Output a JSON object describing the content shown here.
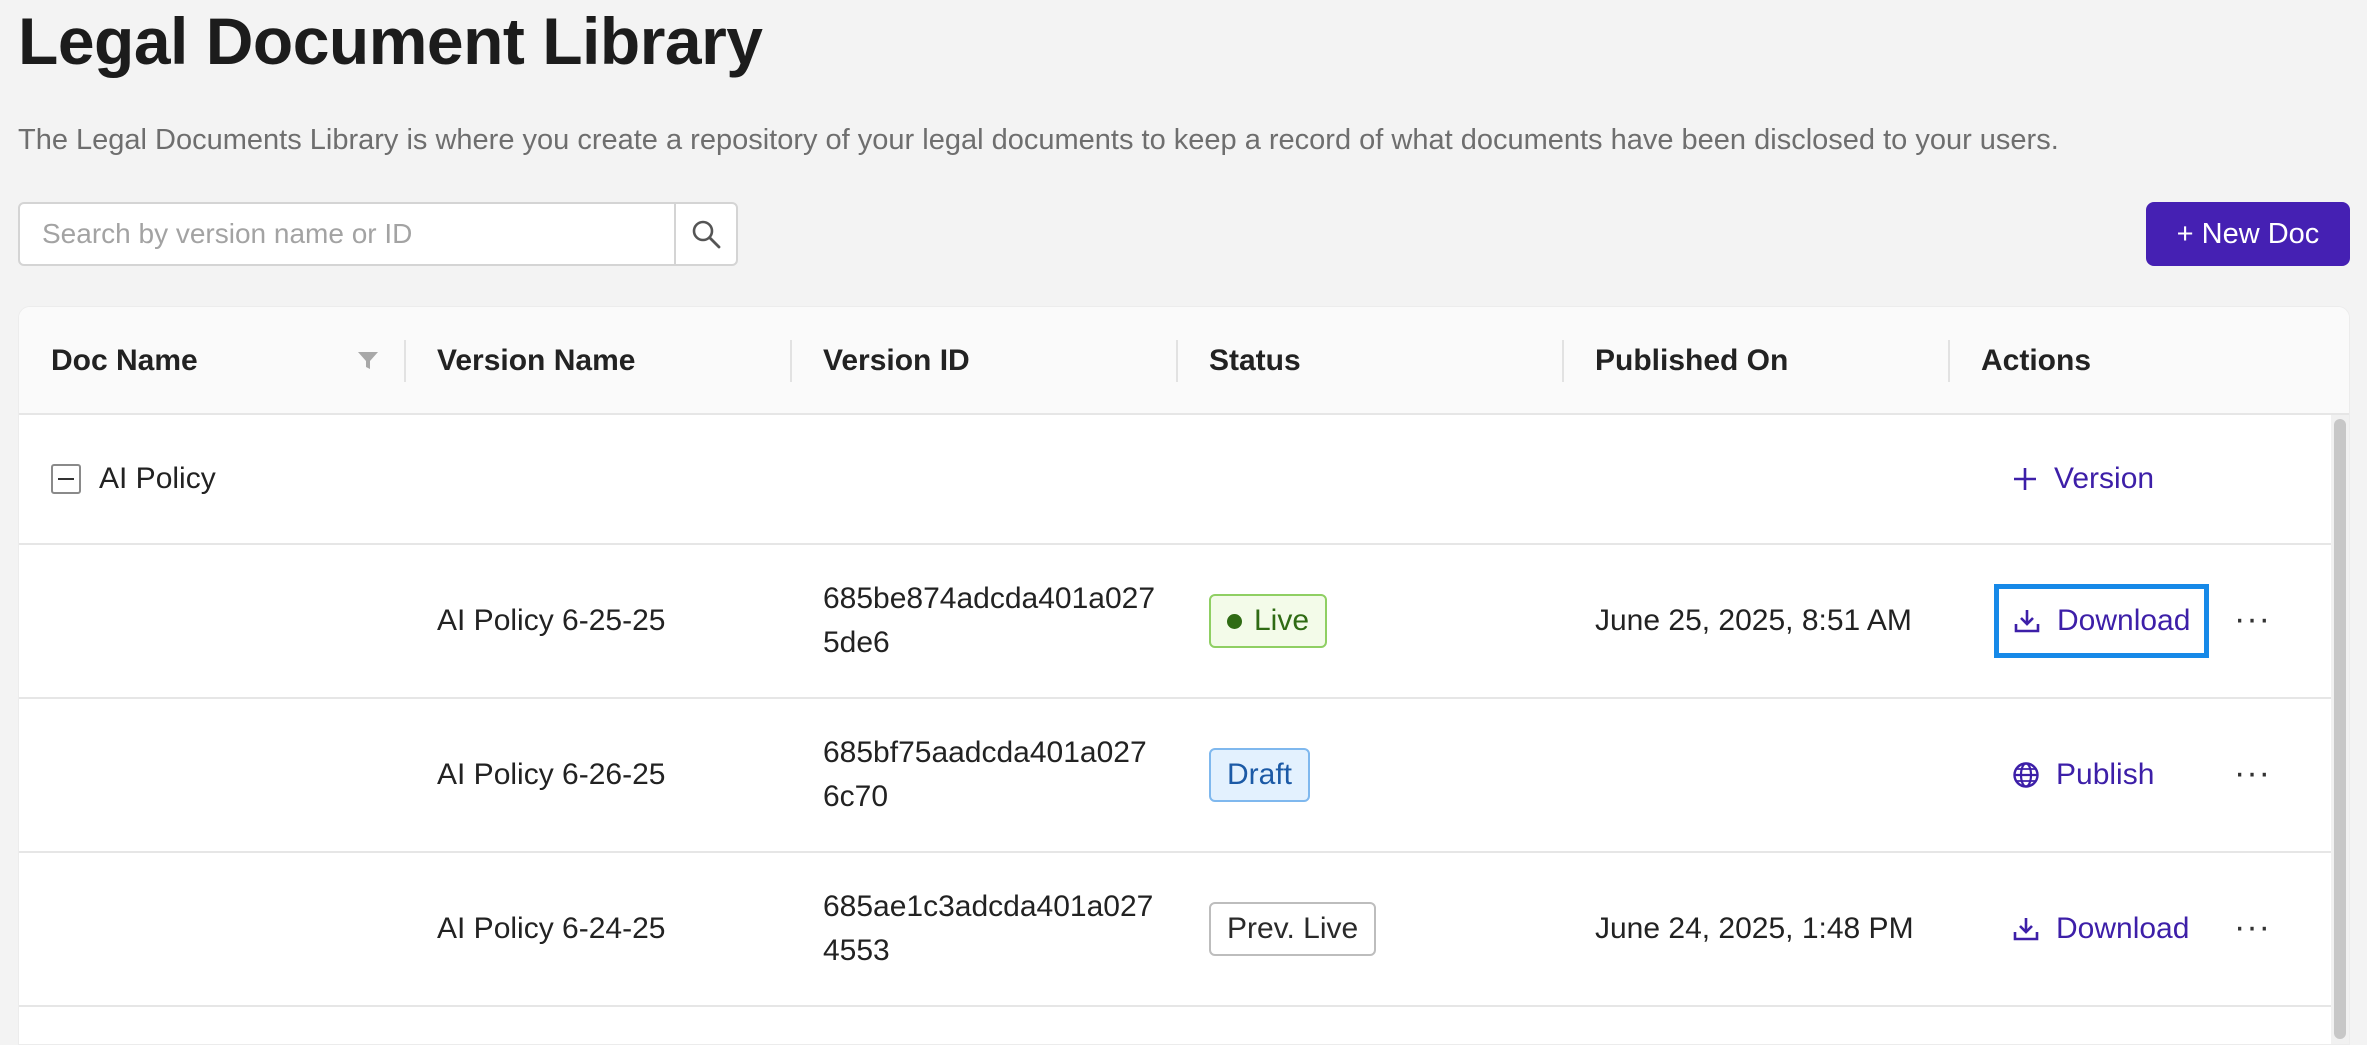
{
  "page": {
    "title": "Legal Document Library",
    "description": "The Legal Documents Library is where you create a repository of your legal documents to keep a record of what documents have been disclosed to your users."
  },
  "search": {
    "placeholder": "Search by version name or ID",
    "value": ""
  },
  "toolbar": {
    "new_doc_label": "+ New Doc"
  },
  "table": {
    "columns": [
      "Doc Name",
      "Version Name",
      "Version ID",
      "Status",
      "Published On",
      "Actions"
    ],
    "group": {
      "name": "AI Policy",
      "add_version_label": "Version"
    },
    "rows": [
      {
        "version_name": "AI Policy 6-25-25",
        "version_id_line1": "685be874adcda401a027",
        "version_id_line2": "5de6",
        "status": "Live",
        "published_on": "June 25, 2025, 8:51 AM",
        "action": "Download"
      },
      {
        "version_name": "AI Policy 6-26-25",
        "version_id_line1": "685bf75aadcda401a027",
        "version_id_line2": "6c70",
        "status": "Draft",
        "published_on": "",
        "action": "Publish"
      },
      {
        "version_name": "AI Policy 6-24-25",
        "version_id_line1": "685ae1c3adcda401a027",
        "version_id_line2": "4553",
        "status": "Prev. Live",
        "published_on": "June 24, 2025, 1:48 PM",
        "action": "Download"
      }
    ],
    "more_label": "···"
  },
  "icons": {
    "search": "search-icon",
    "filter": "filter-icon",
    "collapse": "minus-square-icon",
    "plus": "plus-icon",
    "download": "download-icon",
    "publish": "globe-icon",
    "more": "more-horizontal-icon"
  },
  "colors": {
    "primary": "#4520b3",
    "link": "#3d1fa8",
    "focus_ring": "#1689e8",
    "live_green": "#2f6b14",
    "draft_blue": "#1c5aa6"
  }
}
